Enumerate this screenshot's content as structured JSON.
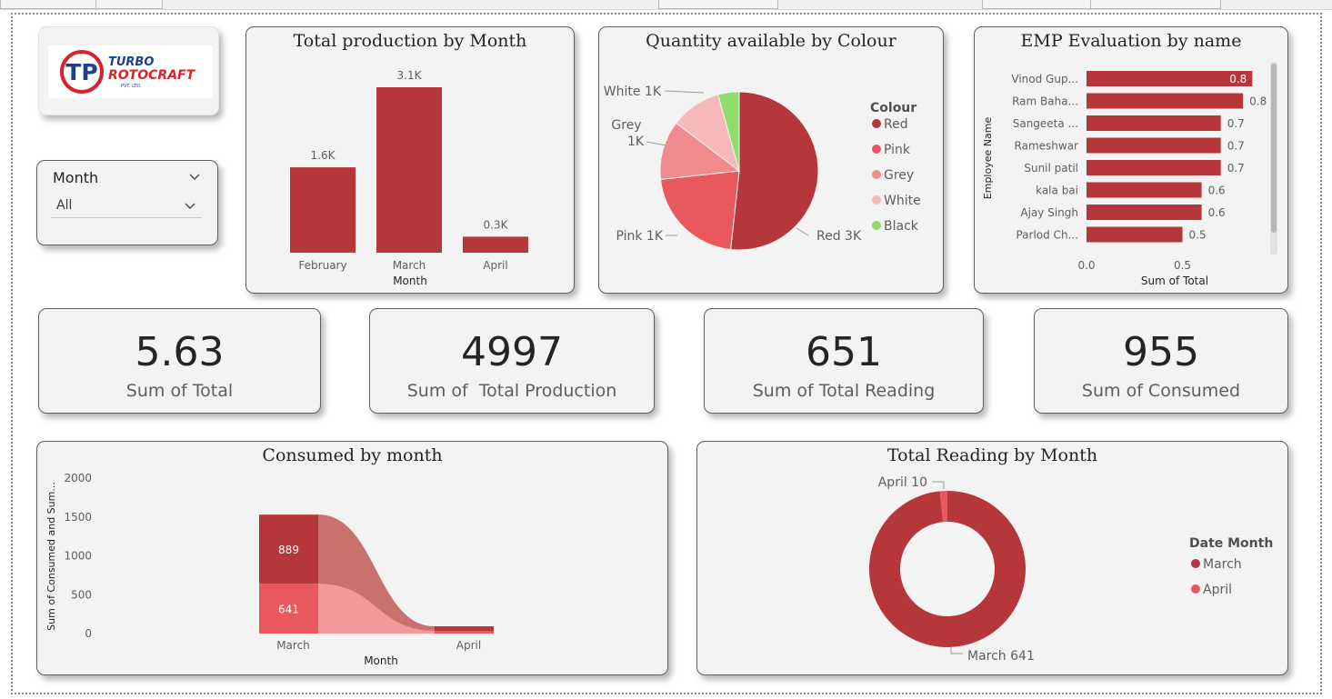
{
  "logo": {
    "line1": "TURBO",
    "line2": "ROTOCRAFT",
    "sub": "PVT. LTD.",
    "monogram": "TP"
  },
  "slicer": {
    "title": "Month",
    "value": "All"
  },
  "colors": {
    "accent": "#b5373a",
    "pink": "#e8585c",
    "grey": "#f08a8c",
    "white": "#f6b8b9",
    "black": "#8fdd6a",
    "light_pink": "#f2999a",
    "muted": "#c8716d"
  },
  "kpis": [
    {
      "value": "5.63",
      "label": "Sum of Total"
    },
    {
      "value": "4997",
      "label": "Sum of  Total Production"
    },
    {
      "value": "651",
      "label": "Sum of Total Reading"
    },
    {
      "value": "955",
      "label": "Sum of Consumed"
    }
  ],
  "chart_data": [
    {
      "id": "production",
      "type": "bar",
      "title": "Total production by Month",
      "xlabel": "Month",
      "ylabel": "",
      "categories": [
        "February",
        "March",
        "April"
      ],
      "values": [
        1600,
        3100,
        300
      ],
      "labels": [
        "1.6K",
        "3.1K",
        "0.3K"
      ],
      "ylim": [
        0,
        3100
      ],
      "grid": false
    },
    {
      "id": "colour",
      "type": "pie",
      "title": "Quantity available by Colour",
      "legend_title": "Colour",
      "legend_position": "right",
      "slices": [
        {
          "name": "Red",
          "value": 3000,
          "label": "Red 3K",
          "color": "#b5373a"
        },
        {
          "name": "Pink",
          "value": 1250,
          "label": "Pink 1K",
          "color": "#e8585c"
        },
        {
          "name": "Grey",
          "value": 700,
          "label": "Grey 1K",
          "color": "#f08a8c"
        },
        {
          "name": "White",
          "value": 600,
          "label": "White 1K",
          "color": "#f6b8b9"
        },
        {
          "name": "Black",
          "value": 250,
          "label": "",
          "color": "#8fdd6a"
        }
      ]
    },
    {
      "id": "emp",
      "type": "bar",
      "orientation": "horizontal",
      "title": "EMP Evaluation by name",
      "xlabel": "Sum of Total",
      "ylabel": "Employee Name",
      "categories": [
        "Vinod Gup...",
        "Ram Baha...",
        "Sangeeta ...",
        "Rameshwar",
        "Sunil patil",
        "kala bai",
        "Ajay Singh",
        "Parlod Ch..."
      ],
      "values": [
        0.8,
        0.8,
        0.7,
        0.7,
        0.7,
        0.6,
        0.6,
        0.5
      ],
      "labels": [
        "0.8",
        "0.8",
        "0.7",
        "0.7",
        "0.7",
        "0.6",
        "0.6",
        "0.5"
      ],
      "xticks": [
        "0.0",
        "0.5"
      ],
      "xlim": [
        0,
        0.85
      ]
    },
    {
      "id": "consumed",
      "type": "area",
      "subtype": "ribbon",
      "title": "Consumed by month",
      "xlabel": "Month",
      "ylabel": "Sum of Consumed and Sum...",
      "categories": [
        "March",
        "April"
      ],
      "series": [
        {
          "values": [
            889,
            50
          ],
          "color": "#b5373a",
          "label": "889"
        },
        {
          "values": [
            641,
            10
          ],
          "color": "#e8585c",
          "label": "641"
        }
      ],
      "yticks": [
        "2000",
        "1500",
        "1000",
        "500",
        "0"
      ],
      "ylim": [
        0,
        2000
      ]
    },
    {
      "id": "reading",
      "type": "pie",
      "subtype": "donut",
      "title": "Total Reading by Month",
      "legend_title": "Date Month",
      "legend_position": "right",
      "slices": [
        {
          "name": "March",
          "value": 641,
          "label": "March 641",
          "color": "#b5373a"
        },
        {
          "name": "April",
          "value": 10,
          "label": "April 10",
          "color": "#e8585c"
        }
      ]
    }
  ]
}
